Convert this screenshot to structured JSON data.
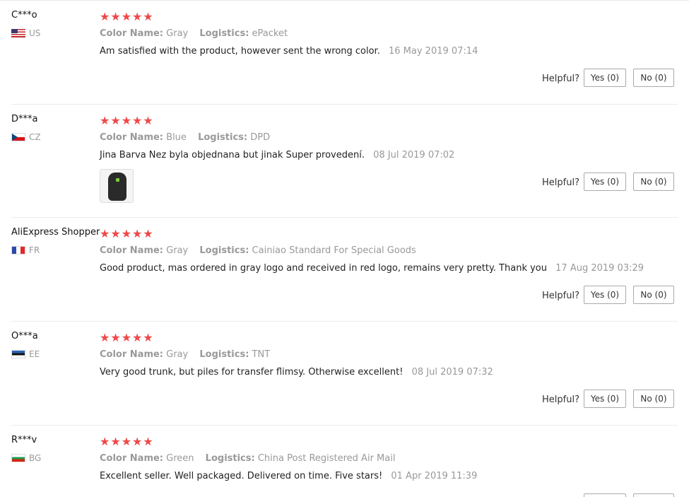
{
  "colors": {
    "star": "#f04848",
    "muted": "#999999"
  },
  "labels": {
    "color_name": "Color Name:",
    "logistics": "Logistics:",
    "helpful": "Helpful?",
    "yes": "Yes (0)",
    "no": "No (0)",
    "star_glyphs": "★★★★★"
  },
  "reviews": [
    {
      "user": "C***o",
      "country": "US",
      "rating": 5,
      "color": "Gray",
      "logistics": "ePacket",
      "text": "Am satisfied with the product, however sent the wrong color.",
      "date": "16 May 2019 07:14"
    },
    {
      "user": "D***a",
      "country": "CZ",
      "rating": 5,
      "color": "Blue",
      "logistics": "DPD",
      "text": "Jina Barva Nez byla objednana but jinak Super provedení.",
      "date": "08 Jul 2019 07:02",
      "has_photo": true
    },
    {
      "user": "AliExpress Shopper",
      "country": "FR",
      "rating": 5,
      "color": "Gray",
      "logistics": "Cainiao Standard For Special Goods",
      "text": "Good product, mas ordered in gray logo and received in red logo, remains very pretty. Thank you",
      "date": "17 Aug 2019 03:29"
    },
    {
      "user": "O***a",
      "country": "EE",
      "rating": 5,
      "color": "Gray",
      "logistics": "TNT",
      "text": "Very good trunk, but piles for transfer flimsy. Otherwise excellent!",
      "date": "08 Jul 2019 07:32"
    },
    {
      "user": "R***v",
      "country": "BG",
      "rating": 5,
      "color": "Green",
      "logistics": "China Post Registered Air Mail",
      "text": "Excellent seller. Well packaged. Delivered on time. Five stars!",
      "date": "01 Apr 2019 11:39"
    }
  ]
}
